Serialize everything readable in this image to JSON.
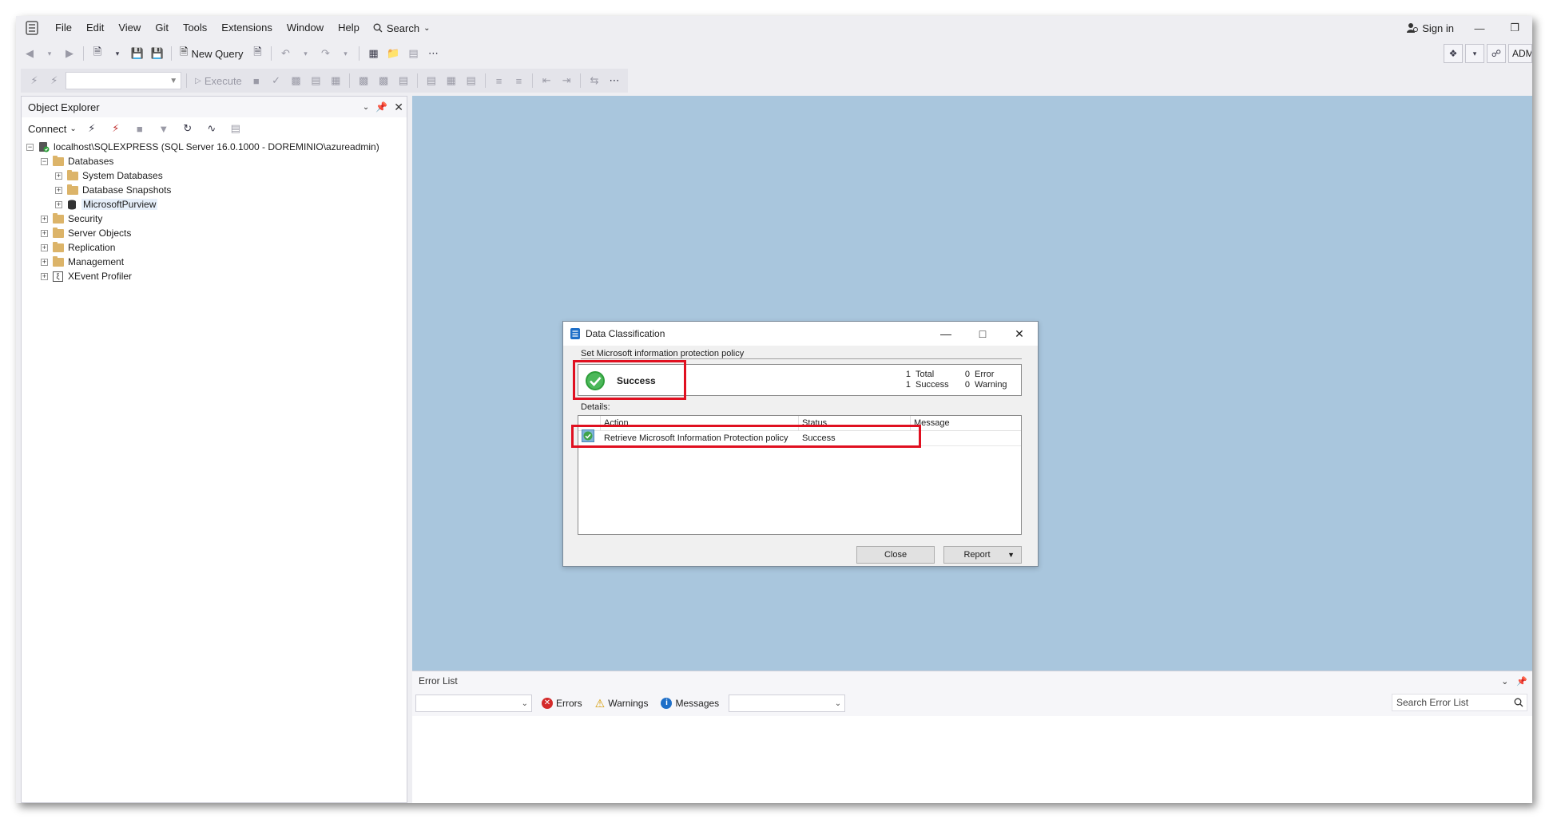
{
  "menu": {
    "items": [
      "File",
      "Edit",
      "View",
      "Git",
      "Tools",
      "Extensions",
      "Window",
      "Help"
    ],
    "search_label": "Search",
    "sign_in": "Sign in"
  },
  "toolbar": {
    "new_query": "New Query",
    "execute": "Execute",
    "account_short": "ADM"
  },
  "object_explorer": {
    "title": "Object Explorer",
    "connect_label": "Connect",
    "server": "localhost\\SQLEXPRESS (SQL Server 16.0.1000 - DOREMINIO\\azureadmin)",
    "databases": "Databases",
    "system_databases": "System Databases",
    "database_snapshots": "Database Snapshots",
    "microsoft_purview": "MicrosoftPurview",
    "security": "Security",
    "server_objects": "Server Objects",
    "replication": "Replication",
    "management": "Management",
    "xevent_profiler": "XEvent Profiler"
  },
  "error_list": {
    "title": "Error List",
    "errors_label": "Errors",
    "warnings_label": "Warnings",
    "messages_label": "Messages",
    "search_placeholder": "Search Error List"
  },
  "dialog": {
    "title": "Data Classification",
    "section": "Set Microsoft information protection policy",
    "summary_status": "Success",
    "stats": {
      "total_count": "1",
      "total_label": "Total",
      "error_count": "0",
      "error_label": "Error",
      "success_count": "1",
      "success_label": "Success",
      "warning_count": "0",
      "warning_label": "Warning"
    },
    "details_label": "Details:",
    "columns": {
      "action": "Action",
      "status": "Status",
      "message": "Message"
    },
    "rows": [
      {
        "action": "Retrieve Microsoft Information Protection policy",
        "status": "Success",
        "message": ""
      }
    ],
    "close_button": "Close",
    "report_button": "Report"
  },
  "colors": {
    "editor_background": "#a9c6dd",
    "highlight": "#e01020",
    "success_green": "#2e9e3a"
  }
}
